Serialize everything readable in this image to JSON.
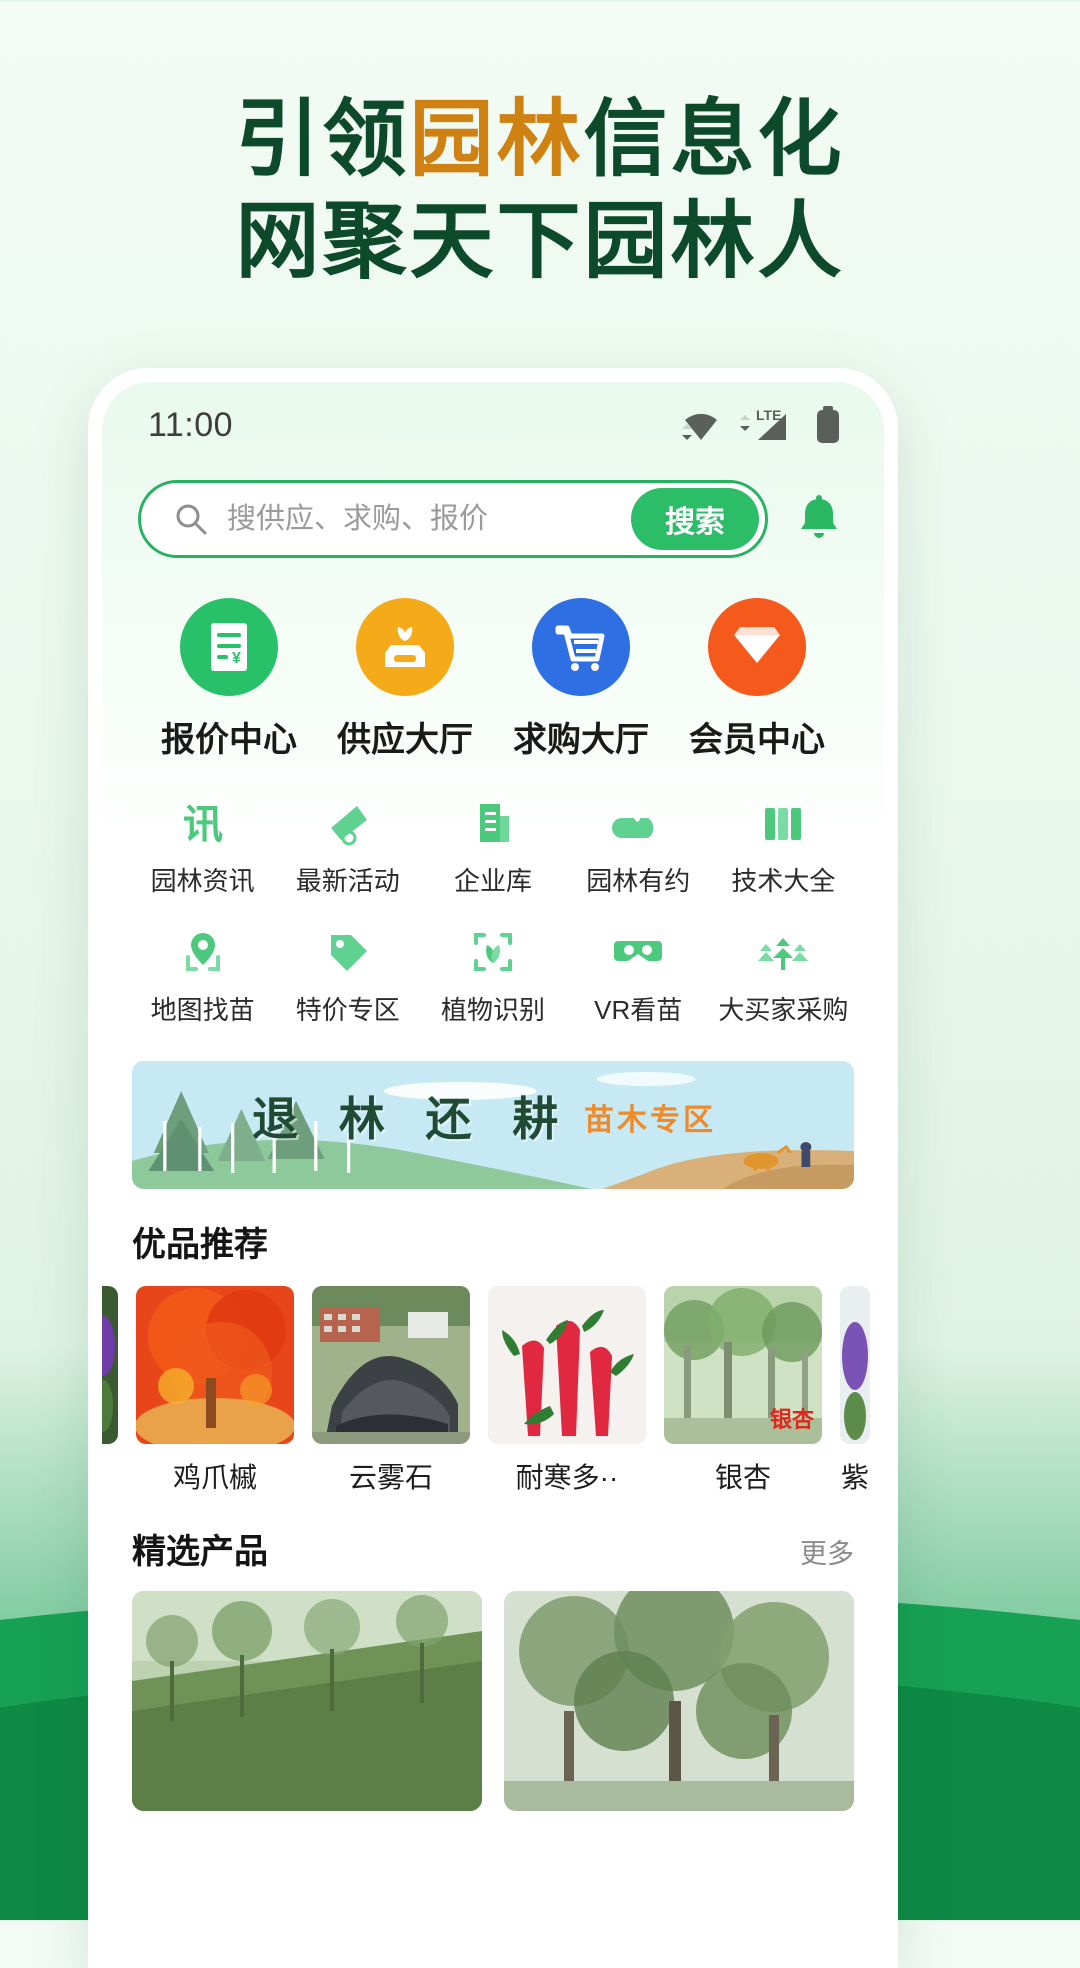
{
  "promo": {
    "headline_line1_pre": "引领",
    "headline_line1_accent": "园林",
    "headline_line1_post": "信息化",
    "headline_line2": "网聚天下园林人"
  },
  "statusbar": {
    "time": "11:00",
    "wifi_icon": "wifi-icon",
    "signal_icon": "lte-signal-icon",
    "signal_label": "LTE",
    "battery_icon": "battery-icon"
  },
  "search": {
    "placeholder": "搜供应、求购、报价",
    "value": "",
    "button_label": "搜索",
    "search_icon": "search-icon",
    "bell_icon": "bell-icon"
  },
  "primary_entries": [
    {
      "label": "报价中心",
      "color": "#29c06a",
      "icon": "price-list-icon"
    },
    {
      "label": "供应大厅",
      "color": "#f5ab19",
      "icon": "seedling-box-icon"
    },
    {
      "label": "求购大厅",
      "color": "#2f6fe4",
      "icon": "shopping-cart-icon"
    },
    {
      "label": "会员中心",
      "color": "#f5591b",
      "icon": "diamond-icon"
    }
  ],
  "quick_grid": [
    {
      "label": "园林资讯",
      "icon": "news-icon"
    },
    {
      "label": "最新活动",
      "icon": "megaphone-icon"
    },
    {
      "label": "企业库",
      "icon": "building-icon"
    },
    {
      "label": "园林有约",
      "icon": "teapot-icon"
    },
    {
      "label": "技术大全",
      "icon": "books-icon"
    },
    {
      "label": "地图找苗",
      "icon": "map-pin-icon"
    },
    {
      "label": "特价专区",
      "icon": "price-tag-icon"
    },
    {
      "label": "植物识别",
      "icon": "scan-plant-icon"
    },
    {
      "label": "VR看苗",
      "icon": "vr-goggles-icon"
    },
    {
      "label": "大买家采购",
      "icon": "tree-group-icon"
    }
  ],
  "banner": {
    "main_text": "退 林 还 耕",
    "sub_text": "苗木专区"
  },
  "recommend": {
    "title": "优品推荐",
    "items": [
      {
        "name": "",
        "thumb": "purple-flower-photo",
        "edge": true
      },
      {
        "name": "鸡爪槭",
        "thumb": "red-maple-photo"
      },
      {
        "name": "云雾石",
        "thumb": "grey-rock-photo"
      },
      {
        "name": "耐寒多··",
        "thumb": "red-bottlebrush-photo"
      },
      {
        "name": "银杏",
        "thumb": "ginkgo-photo",
        "badge": "银杏"
      },
      {
        "name": "紫",
        "thumb": "purple-bloom-photo",
        "edge": true
      }
    ]
  },
  "featured": {
    "title": "精选产品",
    "more_label": "更多",
    "items": [
      {
        "thumb": "nursery-field-photo"
      },
      {
        "thumb": "tree-canopy-photo"
      }
    ]
  },
  "colors": {
    "brand_green": "#26b35f",
    "headline_dark": "#0d4a2b",
    "headline_accent": "#cf8111"
  }
}
